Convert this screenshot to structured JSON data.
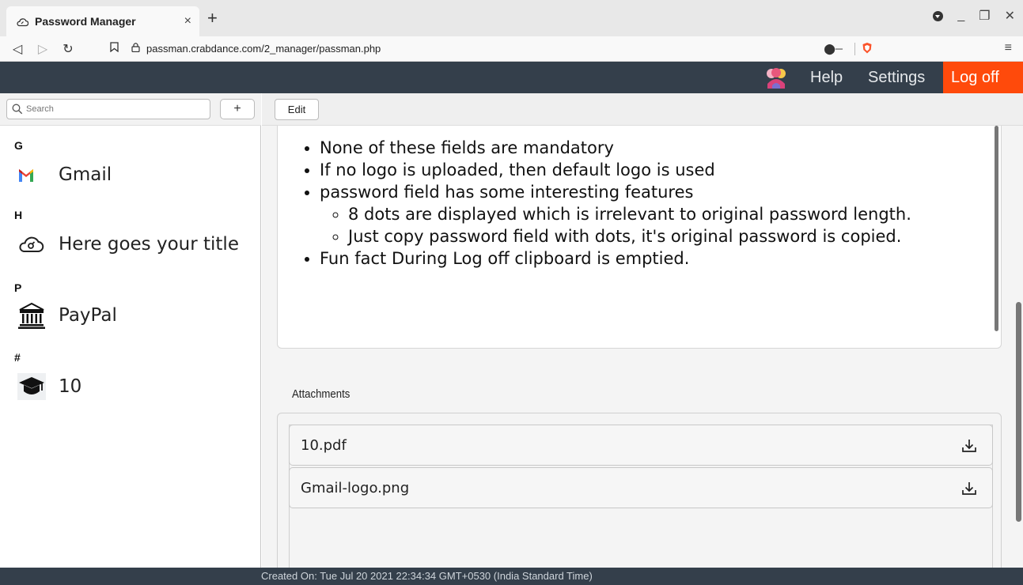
{
  "browser": {
    "tab_title": "Password Manager",
    "tab_close": "×",
    "new_tab": "+",
    "url": "passman.crabdance.com/2_manager/passman.php"
  },
  "navbar": {
    "help": "Help",
    "settings": "Settings",
    "logoff": "Log off",
    "colors": {
      "background": "#343f4b",
      "logoff": "#ff4a0b"
    }
  },
  "sidebar": {
    "search_placeholder": "Search",
    "add_label": "+",
    "groups": [
      {
        "letter": "G",
        "entry": "Gmail",
        "icon": "gmail-icon"
      },
      {
        "letter": "H",
        "entry": "Here goes your title",
        "icon": "cloud-icon"
      },
      {
        "letter": "P",
        "entry": "PayPal",
        "icon": "bank-icon"
      },
      {
        "letter": "#",
        "entry": "10",
        "icon": "graduation-cap-icon"
      }
    ]
  },
  "main": {
    "edit_label": "Edit",
    "notes": [
      "None of these fields are mandatory",
      "If no logo is uploaded, then default logo is used",
      "password field has some interesting features",
      "8 dots are displayed which is irrelevant to original password length.",
      "Just copy password field with dots, it's original password is copied.",
      "Fun fact During Log off clipboard is emptied."
    ],
    "attachments_label": "Attachments",
    "attachments": [
      "10.pdf",
      "Gmail-logo.png"
    ]
  },
  "footer": {
    "created": "Created On: Tue Jul 20 2021 22:34:34 GMT+0530 (India Standard Time)"
  }
}
